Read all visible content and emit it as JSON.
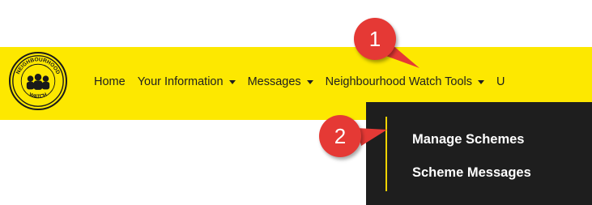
{
  "navbar": {
    "bg_color": "#fde800",
    "logo": {
      "text_top": "NEIGHBOURHOOD",
      "text_bottom": "WATCH",
      "icon": "neighbourhood-watch-logo"
    },
    "items": [
      {
        "label": "Home",
        "has_dropdown": false
      },
      {
        "label": "Your Information",
        "has_dropdown": true
      },
      {
        "label": "Messages",
        "has_dropdown": true
      },
      {
        "label": "Neighbourhood Watch Tools",
        "has_dropdown": true
      },
      {
        "label": "U",
        "has_dropdown": false
      }
    ]
  },
  "dropdown": {
    "bg_color": "#1e1e1e",
    "accent_color": "#f3d400",
    "items": [
      {
        "label": "Manage Schemes"
      },
      {
        "label": "Scheme Messages"
      }
    ]
  },
  "callouts": [
    {
      "label": "1",
      "color": "#e53935"
    },
    {
      "label": "2",
      "color": "#e53935"
    }
  ]
}
